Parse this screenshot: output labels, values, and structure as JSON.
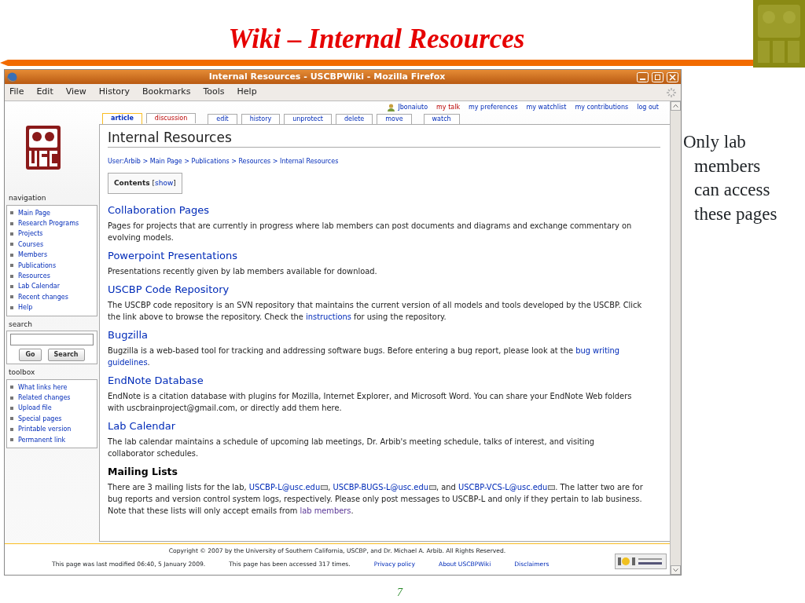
{
  "slide": {
    "title": "Wiki – Internal Resources",
    "note": "Only lab members can access these pages",
    "page_number": "7"
  },
  "window": {
    "title": "Internal Resources - USCBPWiki - Mozilla Firefox"
  },
  "menu": [
    "File",
    "Edit",
    "View",
    "History",
    "Bookmarks",
    "Tools",
    "Help"
  ],
  "personal_links": [
    {
      "label": "Jbonaiuto",
      "kind": "user"
    },
    {
      "label": "my talk",
      "kind": "alert"
    },
    {
      "label": "my preferences",
      "kind": "link"
    },
    {
      "label": "my watchlist",
      "kind": "link"
    },
    {
      "label": "my contributions",
      "kind": "link"
    },
    {
      "label": "log out",
      "kind": "link"
    }
  ],
  "tab_groups": [
    [
      {
        "label": "article",
        "selected": true,
        "missing": false
      },
      {
        "label": "discussion",
        "selected": false,
        "missing": true
      }
    ],
    [
      {
        "label": "edit",
        "selected": false,
        "missing": false
      },
      {
        "label": "history",
        "selected": false,
        "missing": false
      },
      {
        "label": "unprotect",
        "selected": false,
        "missing": false
      },
      {
        "label": "delete",
        "selected": false,
        "missing": false
      },
      {
        "label": "move",
        "selected": false,
        "missing": false
      }
    ],
    [
      {
        "label": "watch",
        "selected": false,
        "missing": false
      }
    ]
  ],
  "sidebar": {
    "navigation": {
      "title": "navigation",
      "items": [
        "Main Page",
        "Research Programs",
        "Projects",
        "Courses",
        "Members",
        "Publications",
        "Resources",
        "Lab Calendar",
        "Recent changes",
        "Help"
      ]
    },
    "search": {
      "title": "search",
      "buttons": [
        "Go",
        "Search"
      ]
    },
    "toolbox": {
      "title": "toolbox",
      "items": [
        "What links here",
        "Related changes",
        "Upload file",
        "Special pages",
        "Printable version",
        "Permanent link"
      ]
    }
  },
  "article": {
    "title": "Internal Resources",
    "breadcrumb": {
      "separator": ">",
      "items": [
        "User:Arbib",
        "Main Page",
        "Publications",
        "Resources",
        "Internal Resources"
      ]
    },
    "toc": {
      "title": "Contents",
      "toggle": "show",
      "brackets": [
        "[",
        "]"
      ]
    },
    "sections": [
      {
        "heading": "Collaboration Pages",
        "kind": "link",
        "runs": [
          {
            "text": "Pages for projects that are currently in progress where lab members can post documents and diagrams and exchange commentary on evolving models.",
            "kind": "text"
          }
        ]
      },
      {
        "heading": "Powerpoint Presentations",
        "kind": "link",
        "runs": [
          {
            "text": "Presentations recently given by lab members available for download.",
            "kind": "text"
          }
        ]
      },
      {
        "heading": "USCBP Code Repository",
        "kind": "link",
        "runs": [
          {
            "text": "The USCBP code repository is an SVN repository that maintains the current version of all models and tools developed by the USCBP. Click the link above to browse the repository. Check the ",
            "kind": "text"
          },
          {
            "text": "instructions",
            "kind": "link"
          },
          {
            "text": " for using the repository.",
            "kind": "text"
          }
        ]
      },
      {
        "heading": "Bugzilla",
        "kind": "link",
        "runs": [
          {
            "text": "Bugzilla is a web-based tool for tracking and addressing software bugs. Before entering a bug report, please look at the ",
            "kind": "text"
          },
          {
            "text": "bug writing",
            "kind": "link"
          },
          {
            "text": "guidelines",
            "kind": "link",
            "space_before": true
          },
          {
            "text": ".",
            "kind": "text"
          }
        ]
      },
      {
        "heading": "EndNote Database",
        "kind": "link",
        "runs": [
          {
            "text": "EndNote is a citation database with plugins for Mozilla, Internet Explorer, and Microsoft Word. You can share your EndNote Web folders with uscbrainproject@gmail.com, or directly add them here.",
            "kind": "text"
          }
        ]
      },
      {
        "heading": "Lab Calendar",
        "kind": "link",
        "runs": [
          {
            "text": "The lab calendar maintains a schedule of upcoming lab meetings, Dr. Arbib's meeting schedule, talks of interest, and visiting collaborator schedules.",
            "kind": "text"
          }
        ]
      },
      {
        "heading": "Mailing Lists",
        "kind": "plain",
        "runs": [
          {
            "text": "There are 3 mailing lists for the lab, ",
            "kind": "text"
          },
          {
            "text": "USCBP-L@usc.edu",
            "kind": "mail"
          },
          {
            "text": ", ",
            "kind": "text"
          },
          {
            "text": "USCBP-BUGS-L@usc.edu",
            "kind": "mail"
          },
          {
            "text": ", and ",
            "kind": "text"
          },
          {
            "text": "USCBP-VCS-L@usc.edu",
            "kind": "mail"
          },
          {
            "text": ". The latter two are for bug reports and version control system logs, respectively. Please only post messages to USCBP-L and only if they pertain to lab business. Note that these lists will only accept emails from ",
            "kind": "text"
          },
          {
            "text": "lab members",
            "kind": "visited"
          },
          {
            "text": ".",
            "kind": "text"
          }
        ]
      }
    ]
  },
  "footer": {
    "copyright": "Copyright © 2007 by the University of Southern California, USCBP, and Dr. Michael A. Arbib. All Rights Reserved.",
    "items": [
      {
        "text": "This page was last modified 06:40, 5 January 2009.",
        "kind": "text"
      },
      {
        "text": "This page has been accessed 317 times.",
        "kind": "text"
      },
      {
        "text": "Privacy policy",
        "kind": "link"
      },
      {
        "text": "About USCBPWiki",
        "kind": "link"
      },
      {
        "text": "Disclaimers",
        "kind": "link"
      }
    ]
  }
}
